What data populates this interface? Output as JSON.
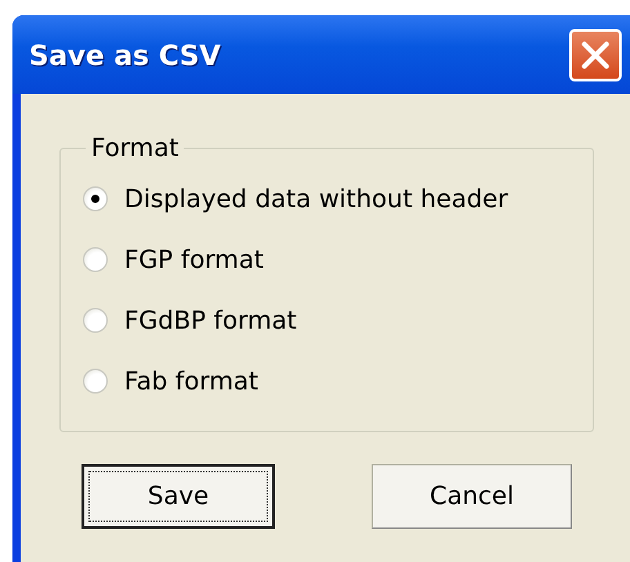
{
  "window": {
    "title": "Save as CSV"
  },
  "group": {
    "label": "Format",
    "options": [
      {
        "label": "Displayed data without header",
        "selected": true
      },
      {
        "label": "FGP format",
        "selected": false
      },
      {
        "label": "FGdBP format",
        "selected": false
      },
      {
        "label": "Fab format",
        "selected": false
      }
    ]
  },
  "buttons": [
    {
      "label": "Save",
      "focused": true
    },
    {
      "label": "Cancel",
      "focused": false
    }
  ]
}
